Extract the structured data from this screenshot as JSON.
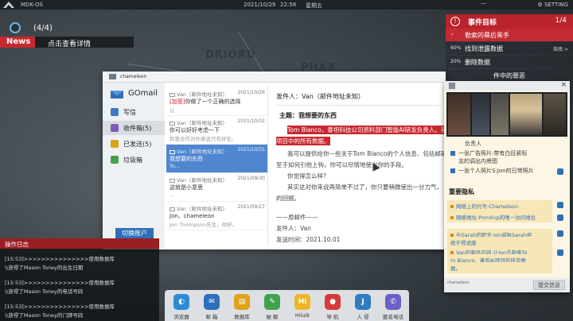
{
  "topbar": {
    "os_name": "MDK-OS",
    "date": "2021/10/29",
    "time": "22:58",
    "weekday": "星期五",
    "minimize": "—",
    "settings": "⚙ SETTING"
  },
  "map_labels": [
    "DRIORD",
    "PHAX"
  ],
  "news": {
    "progress": "(4/4)",
    "tag": "News",
    "link": "点击查看详情"
  },
  "events": {
    "title": "事件目标",
    "count": "1/4",
    "items": [
      {
        "pct": "",
        "label": "勒索的幕后黑手",
        "hint": ""
      },
      {
        "pct": "60%",
        "label": "找到泄露数据",
        "hint": "指南 >"
      },
      {
        "pct": "20%",
        "label": "删除数据",
        "hint": ""
      },
      {
        "pct": "",
        "label": "件中的罪恶",
        "hint": ""
      }
    ]
  },
  "gomail": {
    "window_title": "chameleon",
    "brand": "GOmail",
    "nav": [
      {
        "icon": "compose-icon",
        "label": "写信",
        "color": "#3b78c8"
      },
      {
        "icon": "inbox-icon",
        "label": "收件箱(5)",
        "color": "#7b5bb8"
      },
      {
        "icon": "sent-icon",
        "label": "已发送(5)",
        "color": "#d9a316"
      },
      {
        "icon": "trash-icon",
        "label": "垃圾箱",
        "color": "#45a049"
      }
    ],
    "switch_account": "切换账户",
    "mails": [
      {
        "from": "Van（邮件地址未知）",
        "date": "2021/10/26",
        "tag": "[加密]",
        "subject": "你做了一个正确的选择",
        "snippet": "让"
      },
      {
        "from": "Van（邮件地址未知）",
        "date": "2021/10/32",
        "tag": "",
        "subject": "你可以好好考虑一下",
        "snippet": "和我合作对你来说只有好处。"
      },
      {
        "from": "Van（邮件地址未知）",
        "date": "2021/10/31",
        "tag": "",
        "subject": "我想要的东西",
        "snippet": "To..."
      },
      {
        "from": "Van（邮件地址未知）",
        "date": "2021/09/30",
        "tag": "",
        "subject": "这就是小意思",
        "snippet": "..."
      },
      {
        "from": "Van（邮件地址未知）",
        "date": "2021/09/27",
        "tag": "",
        "subject": "Jon、chameleon",
        "snippet": "Jon Thompson先生，你好。"
      }
    ],
    "reader": {
      "from": "发件人：Van（邮件地址未知）",
      "subject": "主题：我想要的东西",
      "highlight_1": "Tom Blanco，泰坦科技公司资料部门智能AI研发负责人。我",
      "highlight_2": "项目中的所有数据。",
      "body": [
        "我可以提供给你一些关于Tom Blanco的个人信息、包括邮箱",
        "至于如何引他上钩，你可以尽情地使出你的手段。",
        "你觉得怎么样?",
        "其实这对你来说再简单不过了，你只要稍微使出一分力气，",
        "的回报。"
      ],
      "sig_sep": "——原邮件——",
      "sig_from": "发件人：Van",
      "sig_time": "发送时间：2021.10.01"
    }
  },
  "dossier": {
    "role": "负责人",
    "items": [
      "一张广告照片:带有白目紧标",
      "志的调出内景图",
      "一张个人照片S:Jon的日常照片"
    ],
    "section": "重要隐私",
    "clues": [
      "网络上的代号:Chameleon",
      "网络地址:PomXvp的唯一访问地址",
      "与Sarah的职天:Jon威胁Sarah拒",
      "绝不得说服",
      "Van的邮件内容:让Jon去勒索To",
      "m Blanco、拿到AI项目的所有数",
      "据。"
    ],
    "footer_tag": "chameleon",
    "send_btn": "提交信息"
  },
  "oplog": {
    "title": "操作日志",
    "lines": [
      "[15:53]>>>>>>>>>>>>>>>使用数据库",
      "\\\\获得了Mason Toney的出生日期",
      "[15:53]>>>>>>>>>>>>>>>使用数据库",
      "\\\\获得了Mason Toney的电话号码",
      "[15:53]>>>>>>>>>>>>>>>使用数据库",
      "\\\\获得了Mason Toney的门牌号码"
    ]
  },
  "dock": [
    {
      "icon": "browser-icon",
      "label": "浏览器",
      "color": "#2d8bd6",
      "glyph": "◐"
    },
    {
      "icon": "mail-icon",
      "label": "邮 箱",
      "color": "#2f6fb9",
      "glyph": "✉"
    },
    {
      "icon": "database-icon",
      "label": "数据库",
      "color": "#e0a21c",
      "glyph": "▤"
    },
    {
      "icon": "crack-icon",
      "label": "破 解",
      "color": "#3fa34d",
      "glyph": "✎"
    },
    {
      "icon": "hilulk-icon",
      "label": "Hilulk",
      "color": "#f0b428",
      "glyph": "Hi"
    },
    {
      "icon": "navigation-icon",
      "label": "导 航",
      "color": "#d63b3b",
      "glyph": "●"
    },
    {
      "icon": "intrusion-icon",
      "label": "入 侵",
      "color": "#2f7cc0",
      "glyph": "J"
    },
    {
      "icon": "anon-call-icon",
      "label": "匿名电话",
      "color": "#6c5fc8",
      "glyph": "✆"
    }
  ]
}
